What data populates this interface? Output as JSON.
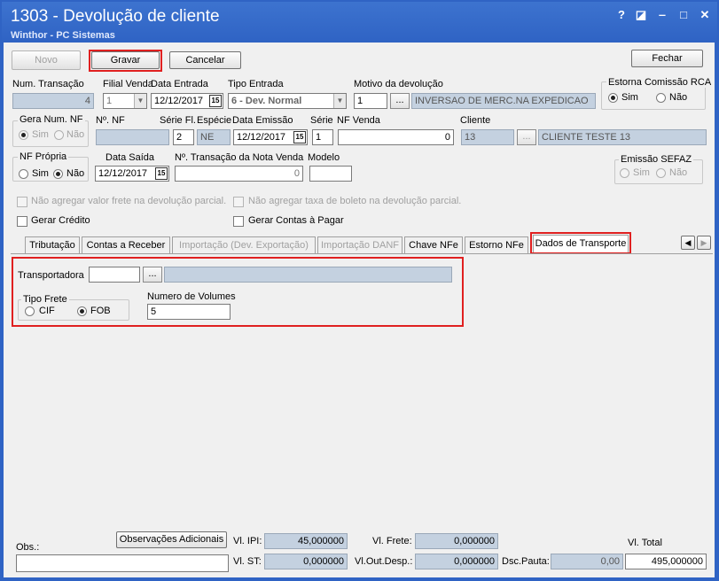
{
  "window": {
    "title": "1303 - Devolução de cliente",
    "subtitle": "Winthor - PC Sistemas",
    "controls": {
      "help": "?",
      "restore": "◪",
      "minimize": "‒",
      "maximize": "□",
      "close": "✕"
    }
  },
  "toolbar": {
    "novo": "Novo",
    "gravar": "Gravar",
    "cancelar": "Cancelar",
    "fechar": "Fechar"
  },
  "header": {
    "num_transacao_label": "Num. Transação",
    "num_transacao_value": "4",
    "filial_venda_label": "Filial Venda",
    "filial_venda_value": "1",
    "data_entrada_label": "Data Entrada",
    "data_entrada_value": "12/12/2017",
    "tipo_entrada_label": "Tipo Entrada",
    "tipo_entrada_value": "6 - Dev. Normal",
    "motivo_label": "Motivo da devolução",
    "motivo_code": "1",
    "motivo_desc": "INVERSAO DE MERC.NA EXPEDICAO",
    "estorna_label": "Estorna Comissão RCA",
    "estorna_sim": "Sim",
    "estorna_nao": "Não",
    "gera_num_nf_label": "Gera Num. NF",
    "gera_sim": "Sim",
    "gera_nao": "Não",
    "num_nf_label": "Nº. NF",
    "serie_fl_label": "Série Fl.",
    "serie_fl_value": "2",
    "especie_label": "Espécie",
    "especie_value": "NE",
    "data_emissao_label": "Data Emissão",
    "data_emissao_value": "12/12/2017",
    "serie_label": "Série",
    "serie_value": "1",
    "nf_venda_label": "NF Venda",
    "nf_venda_value": "0",
    "cliente_label": "Cliente",
    "cliente_code": "13",
    "cliente_name": "CLIENTE TESTE 13",
    "nf_propria_label": "NF Própria",
    "nf_propria_sim": "Sim",
    "nf_propria_nao": "Não",
    "data_saida_label": "Data Saída",
    "data_saida_value": "12/12/2017",
    "num_transacao_nota_label": "Nº. Transação da Nota Venda",
    "num_transacao_nota_value": "0",
    "modelo_label": "Modelo",
    "emissao_sefaz_label": "Emissão SEFAZ",
    "sefaz_sim": "Sim",
    "sefaz_nao": "Não",
    "cal_glyph": "15",
    "dots": "..."
  },
  "checks": {
    "nao_agregar_frete": "Não agregar valor frete na devolução parcial.",
    "nao_agregar_boleto": "Não agregar taxa de boleto na devolução parcial.",
    "gerar_credito": "Gerar Crédito",
    "gerar_contas": "Gerar Contas à Pagar"
  },
  "tabs": {
    "tributacao": "Tributação",
    "contas_receber": "Contas a Receber",
    "importacao_dev": "Importação (Dev. Exportação)",
    "importacao_danf": "Importação DANF",
    "chave_nfe": "Chave NFe",
    "estorno_nfe": "Estorno NFe",
    "dados_transporte": "Dados de Transporte"
  },
  "transporte": {
    "transportadora_label": "Transportadora",
    "tipo_frete_label": "Tipo Frete",
    "cif": "CIF",
    "fob": "FOB",
    "num_volumes_label": "Numero de Volumes",
    "num_volumes_value": "5"
  },
  "footer": {
    "obs_label": "Obs.:",
    "obs_adicionais": "Observações Adicionais",
    "vl_ipi_label": "Vl. IPI:",
    "vl_ipi_value": "45,000000",
    "vl_st_label": "Vl. ST:",
    "vl_st_value": "0,000000",
    "vl_frete_label": "Vl. Frete:",
    "vl_frete_value": "0,000000",
    "vl_out_label": "Vl.Out.Desp.:",
    "vl_out_value": "0,000000",
    "dsc_pauta_label": "Dsc.Pauta:",
    "dsc_pauta_value": "0,00",
    "vl_total_label": "Vl. Total",
    "vl_total_value": "495,000000"
  },
  "colors": {
    "titlebar": "#2f63c4",
    "highlight": "#e02020",
    "readonly": "#c4d1e0"
  },
  "icons": {
    "dropdown": "chevron-down-icon",
    "calendar": "calendar-icon",
    "scroll_left": "arrow-left-icon",
    "scroll_right": "arrow-right-icon"
  }
}
